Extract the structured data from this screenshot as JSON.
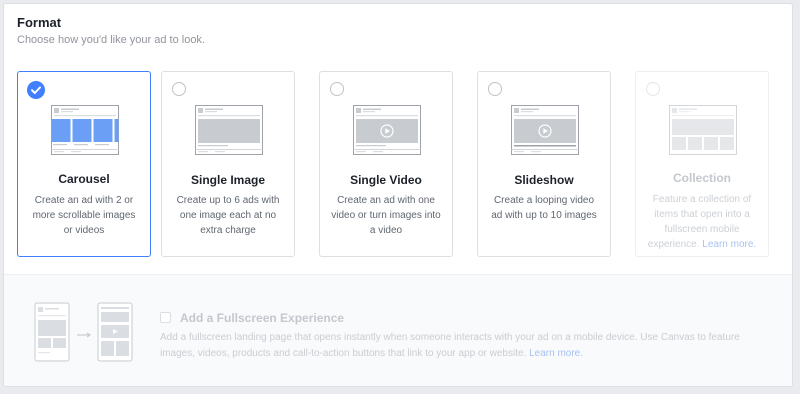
{
  "header": {
    "title": "Format",
    "subtitle": "Choose how you'd like your ad to look."
  },
  "formats": [
    {
      "name": "Carousel",
      "description": "Create an ad with 2 or more scrollable images or videos",
      "selected": true,
      "disabled": false,
      "icon": "carousel-thumbnail"
    },
    {
      "name": "Single Image",
      "description": "Create up to 6 ads with one image each at no extra charge",
      "selected": false,
      "disabled": false,
      "icon": "single-image-thumbnail"
    },
    {
      "name": "Single Video",
      "description": "Create an ad with one video or turn images into a video",
      "selected": false,
      "disabled": false,
      "icon": "single-video-thumbnail"
    },
    {
      "name": "Slideshow",
      "description": "Create a looping video ad with up to 10 images",
      "selected": false,
      "disabled": false,
      "icon": "slideshow-thumbnail"
    },
    {
      "name": "Collection",
      "description": "Feature a collection of items that open into a fullscreen mobile experience.",
      "link": "Learn more.",
      "selected": false,
      "disabled": true,
      "icon": "collection-thumbnail"
    }
  ],
  "fullscreen": {
    "title": "Add a Fullscreen Experience",
    "description": "Add a fullscreen landing page that opens instantly when someone interacts with your ad on a mobile device. Use Canvas to feature images, videos, products and call-to-action buttons that link to your app or website.",
    "link": "Learn more.",
    "checked": false
  },
  "colors": {
    "accent": "#4080ff",
    "carousel_blue": "#6a9ff5",
    "placeholder_gray": "#c8cbd0"
  }
}
